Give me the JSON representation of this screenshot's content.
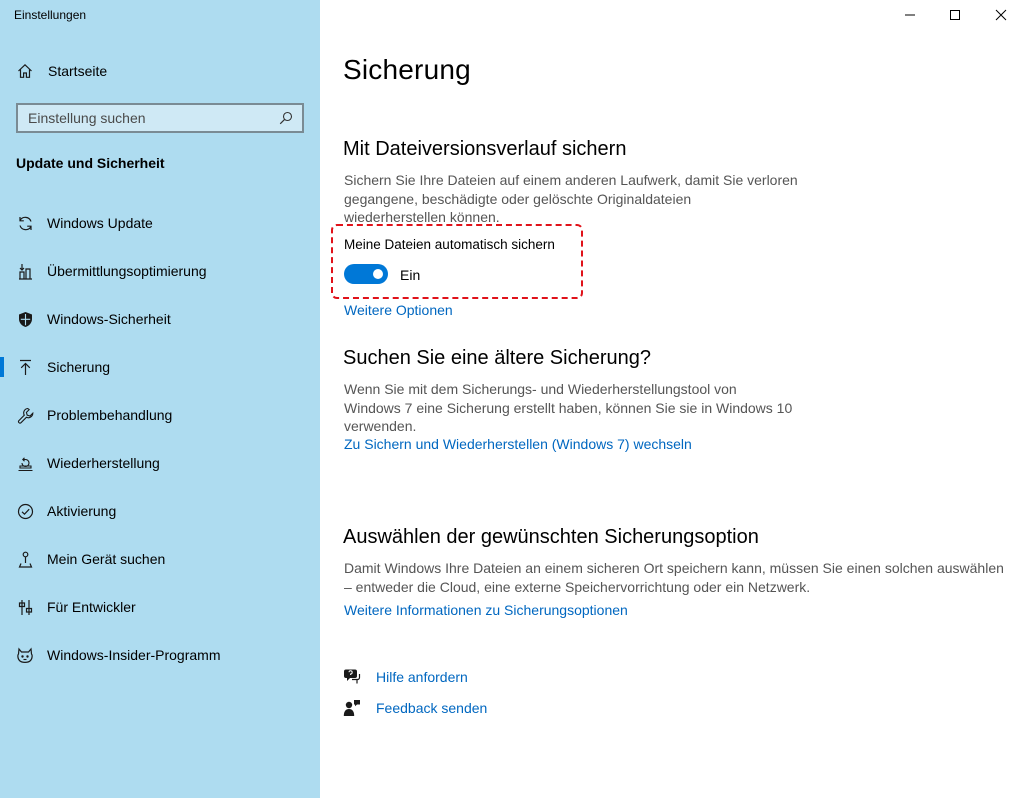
{
  "window": {
    "title": "Einstellungen",
    "controls": [
      "minimize",
      "maximize",
      "close"
    ]
  },
  "sidebar": {
    "home_label": "Startseite",
    "search_placeholder": "Einstellung suchen",
    "section_title": "Update und Sicherheit",
    "items": [
      {
        "label": "Windows Update",
        "icon": "refresh-icon",
        "selected": false
      },
      {
        "label": "Übermittlungsoptimierung",
        "icon": "delivery-optimization-icon",
        "selected": false
      },
      {
        "label": "Windows-Sicherheit",
        "icon": "shield-icon",
        "selected": false
      },
      {
        "label": "Sicherung",
        "icon": "backup-arrow-icon",
        "selected": true
      },
      {
        "label": "Problembehandlung",
        "icon": "wrench-icon",
        "selected": false
      },
      {
        "label": "Wiederherstellung",
        "icon": "recovery-icon",
        "selected": false
      },
      {
        "label": "Aktivierung",
        "icon": "check-circle-icon",
        "selected": false
      },
      {
        "label": "Mein Gerät suchen",
        "icon": "find-device-icon",
        "selected": false
      },
      {
        "label": "Für Entwickler",
        "icon": "developer-icon",
        "selected": false
      },
      {
        "label": "Windows-Insider-Programm",
        "icon": "insider-icon",
        "selected": false
      }
    ]
  },
  "main": {
    "page_title": "Sicherung",
    "file_history": {
      "heading": "Mit Dateiversionsverlauf sichern",
      "description_lines": [
        "Sichern Sie Ihre Dateien auf einem anderen Laufwerk, damit Sie verloren",
        "gegangene, beschädigte oder gelöschte Originaldateien",
        "wiederherstellen können."
      ],
      "toggle_label": "Meine Dateien automatisch sichern",
      "toggle_on": true,
      "toggle_state": "Ein",
      "more_options_link": "Weitere Optionen"
    },
    "older_backup": {
      "heading": "Suchen Sie eine ältere Sicherung?",
      "description_lines": [
        "Wenn Sie mit dem Sicherungs- und Wiederherstellungstool von",
        "Windows 7 eine Sicherung erstellt haben, können Sie sie in Windows 10",
        "verwenden."
      ],
      "link": "Zu Sichern und Wiederherstellen (Windows 7) wechseln"
    },
    "backup_option": {
      "heading": "Auswählen der gewünschten Sicherungsoption",
      "description_lines": [
        "Damit Windows Ihre Dateien an einem sicheren Ort speichern kann, müssen Sie einen solchen auswählen",
        "– entweder die Cloud, eine externe Speichervorrichtung oder ein Netzwerk."
      ],
      "link": "Weitere Informationen zu Sicherungsoptionen"
    },
    "help": {
      "get_help": "Hilfe anfordern",
      "feedback": "Feedback senden"
    }
  },
  "colors": {
    "sidebar_bg": "#aedcf0",
    "accent": "#0078d7",
    "link": "#0067c0",
    "highlight_border": "#e0121a"
  }
}
